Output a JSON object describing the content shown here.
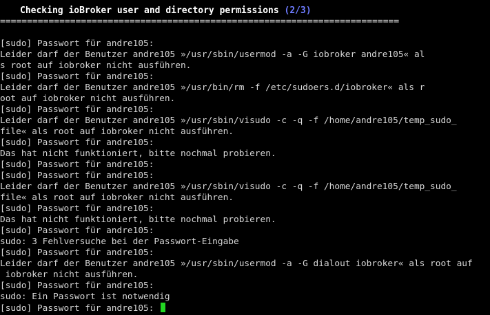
{
  "terminal": {
    "title": "Checking ioBroker user and directory permissions",
    "title_progress": "(2/3)",
    "separator": "==========================================================================",
    "lines": [
      "[sudo] Passwort für andre105:",
      "Leider darf der Benutzer andre105 »/usr/sbin/usermod -a -G iobroker andre105« al",
      "s root auf iobroker nicht ausführen.",
      "[sudo] Passwort für andre105:",
      "Leider darf der Benutzer andre105 »/usr/bin/rm -f /etc/sudoers.d/iobroker« als r",
      "oot auf iobroker nicht ausführen.",
      "[sudo] Passwort für andre105:",
      "Leider darf der Benutzer andre105 »/usr/sbin/visudo -c -q -f /home/andre105/temp_sudo_",
      "file« als root auf iobroker nicht ausführen.",
      "[sudo] Passwort für andre105:",
      "Das hat nicht funktioniert, bitte nochmal probieren.",
      "[sudo] Passwort für andre105:",
      "[sudo] Passwort für andre105:",
      "Leider darf der Benutzer andre105 »/usr/sbin/visudo -c -q -f /home/andre105/temp_sudo_",
      "file« als root auf iobroker nicht ausführen.",
      "[sudo] Passwort für andre105:",
      "Das hat nicht funktioniert, bitte nochmal probieren.",
      "[sudo] Passwort für andre105:",
      "sudo: 3 Fehlversuche bei der Passwort-Eingabe",
      "[sudo] Passwort für andre105:",
      "Leider darf der Benutzer andre105 »/usr/sbin/usermod -a -G dialout iobroker« als root auf",
      " iobroker nicht ausführen.",
      "[sudo] Passwort für andre105:",
      "sudo: Ein Passwort ist notwendig"
    ],
    "prompt": "[sudo] Passwort für andre105: ",
    "colors": {
      "background": "#000000",
      "text": "#d7d7d7",
      "title": "#ffffff",
      "progress": "#6d7bff",
      "cursor": "#22d622"
    }
  }
}
